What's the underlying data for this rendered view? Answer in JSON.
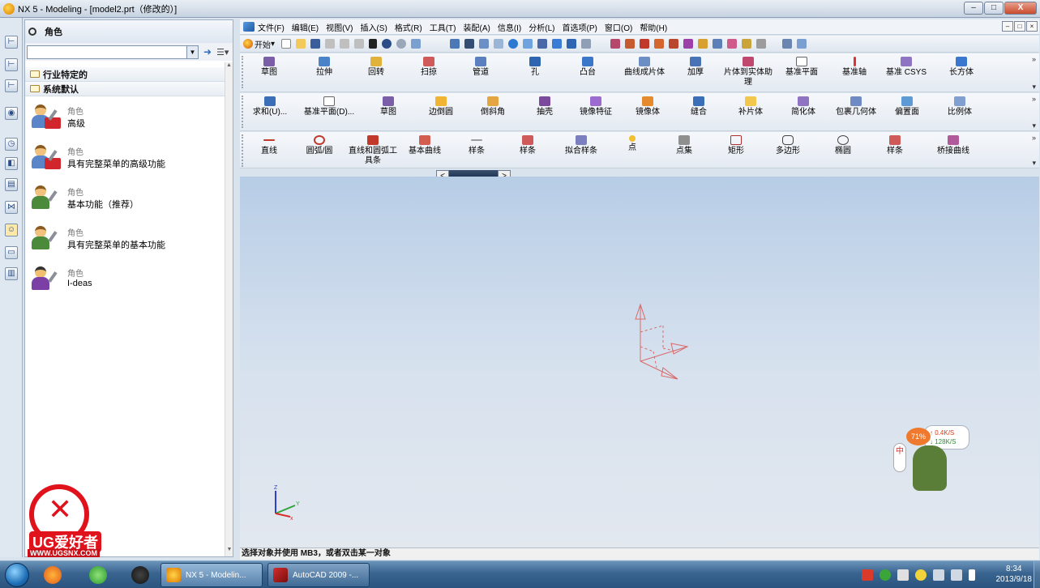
{
  "window": {
    "title": "NX 5 - Modeling - [model2.prt（修改的）]",
    "buttons": {
      "minimize": "–",
      "maximize": "□",
      "close": "X"
    }
  },
  "navigator": {
    "header": "角色",
    "search_value": "",
    "groups": [
      "行业特定的",
      "系统默认"
    ],
    "roles": [
      {
        "type": "角色",
        "name": "高级"
      },
      {
        "type": "角色",
        "name": "具有完整菜单的高级功能"
      },
      {
        "type": "角色",
        "name": "基本功能（推荐）"
      },
      {
        "type": "角色",
        "name": "具有完整菜单的基本功能"
      },
      {
        "type": "角色",
        "name": "I-deas"
      }
    ]
  },
  "menubar": {
    "items": [
      "文件(F)",
      "编辑(E)",
      "视图(V)",
      "插入(S)",
      "格式(R)",
      "工具(T)",
      "装配(A)",
      "信息(I)",
      "分析(L)",
      "首选项(P)",
      "窗口(O)",
      "帮助(H)"
    ],
    "mdi_buttons": [
      "–",
      "□",
      "×"
    ]
  },
  "std_toolbar": {
    "start_label": "开始"
  },
  "toolbar_row1": [
    "草图",
    "拉伸",
    "回转",
    "扫掠",
    "管道",
    "孔",
    "凸台",
    "曲线成片体",
    "加厚",
    "片体到实体助理",
    "基准平面",
    "基准轴",
    "基准 CSYS",
    "长方体"
  ],
  "toolbar_row2": [
    "求和(U)...",
    "基准平面(D)...",
    "草图",
    "边倒圆",
    "倒斜角",
    "抽壳",
    "镜像特征",
    "镜像体",
    "缝合",
    "补片体",
    "简化体",
    "包裹几何体",
    "偏置面",
    "比例体"
  ],
  "toolbar_row3": [
    "直线",
    "圆弧/圆",
    "直线和圆弧工具条",
    "基本曲线",
    "样条",
    "样条",
    "拟合样条",
    "点",
    "点集",
    "矩形",
    "多边形",
    "椭圆",
    "样条",
    "桥接曲线"
  ],
  "statusbar": {
    "prompt": "选择对象并使用 MB3，或者双击某一对象"
  },
  "axis_labels": {
    "x": "x",
    "y": "Y",
    "z": "Z"
  },
  "netmon": {
    "percent": "71%",
    "upload": "0.4K/S",
    "download": "128K/S",
    "side_char": "中"
  },
  "logo": {
    "brand": "UG爱好者",
    "url": "WWW.UGSNX.COM"
  },
  "taskbar": {
    "tasks": [
      {
        "label": "NX 5 - Modelin...",
        "active": true
      },
      {
        "label": "AutoCAD 2009 -...",
        "active": false
      }
    ],
    "clock_time": "8:34",
    "clock_date": "2013/9/18"
  },
  "colors": {
    "accent": "#2d6cc4",
    "csys_red": "#d96a6a",
    "logo_red": "#e0121b",
    "graphics_top": "#b7cde6",
    "graphics_bottom": "#e3e8ef"
  }
}
